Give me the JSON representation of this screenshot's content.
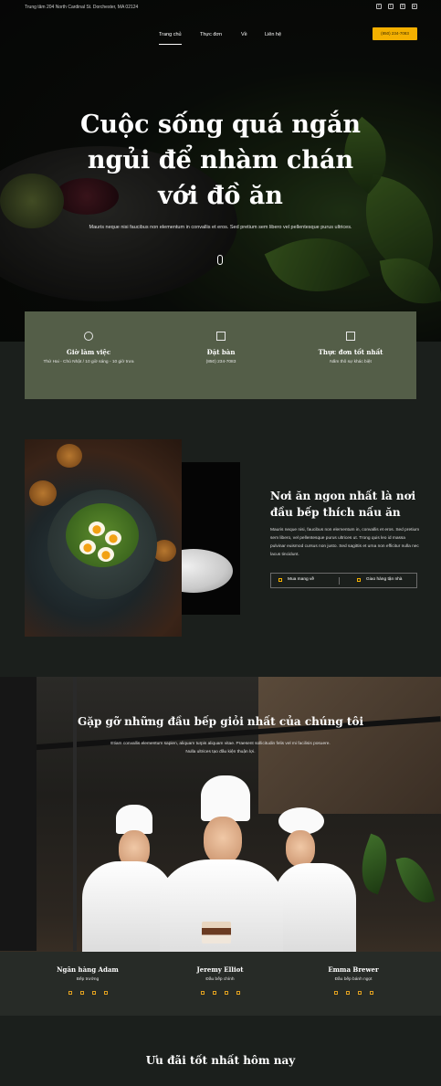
{
  "topbar": {
    "address": "Trung tâm 204 North Cardinal St. Dorchester, MA 02124",
    "socials": [
      "facebook-icon",
      "twitter-icon",
      "instagram-icon",
      "youtube-icon"
    ]
  },
  "nav": {
    "items": [
      "Trang chủ",
      "Thực đơn",
      "Về",
      "Liên hệ"
    ],
    "active": "Trang chủ",
    "phone": "(850) 234-7083"
  },
  "hero": {
    "title_line1": "Cuộc sống quá ngắn",
    "title_line2": "ngủi để nhàm chán",
    "title_line3": "với đồ ăn",
    "subtitle": "Mauris neque nisi faucibus non elementum in convallis et eros. Sed pretium sem libero vel pellentesque purus ultrices."
  },
  "info": {
    "items": [
      {
        "icon": "clock-icon",
        "title": "Giờ làm việc",
        "text": "Thứ Hai - Chủ Nhật / 10 giờ sáng - 10 giờ trưa"
      },
      {
        "icon": "book-icon",
        "title": "Đặt bàn",
        "text": "(850) 234-7083"
      },
      {
        "icon": "menu-board-icon",
        "title": "Thực đơn tốt nhất",
        "text": "Nấm thô sự khác biệt"
      }
    ]
  },
  "about": {
    "title": "Nơi ăn ngon nhất là nơi đầu bếp thích nấu ăn",
    "text": "Mauris neque nisi, faucibus non elementum in, convallis et eros. Sed pretium sem libero, vel pellentesque purus ultrices ut. Trong quis leo id massa pulvinar euismod cursus non justo. Sed sagittis et urna non efficitur nulla nec lacus tincidunt.",
    "button1": "Mua mang về",
    "button2": "Giao hàng tận nhà"
  },
  "chefs": {
    "title": "Gặp gỡ những đầu bếp giỏi nhất của chúng tôi",
    "subtitle": "Etiam convallis elementum sapien, aliquam turpis aliquam vitae. Praesent sollicitudin felis vel mi facilisis posuere. Nulla ultrices tạo đầu kiện thuận lợi.",
    "people": [
      {
        "name": "Ngân hàng Adam",
        "role": "Bếp trưởng"
      },
      {
        "name": "Jeremy Elliot",
        "role": "Đầu bếp chính"
      },
      {
        "name": "Emma Brewer",
        "role": "Đầu bếp bánh ngọt"
      }
    ]
  },
  "offers": {
    "title": "Ưu đãi tốt nhất hôm nay"
  },
  "colors": {
    "accent": "#f4b000",
    "info_bg": "#545e48",
    "page_bg": "#1b1f1c"
  }
}
